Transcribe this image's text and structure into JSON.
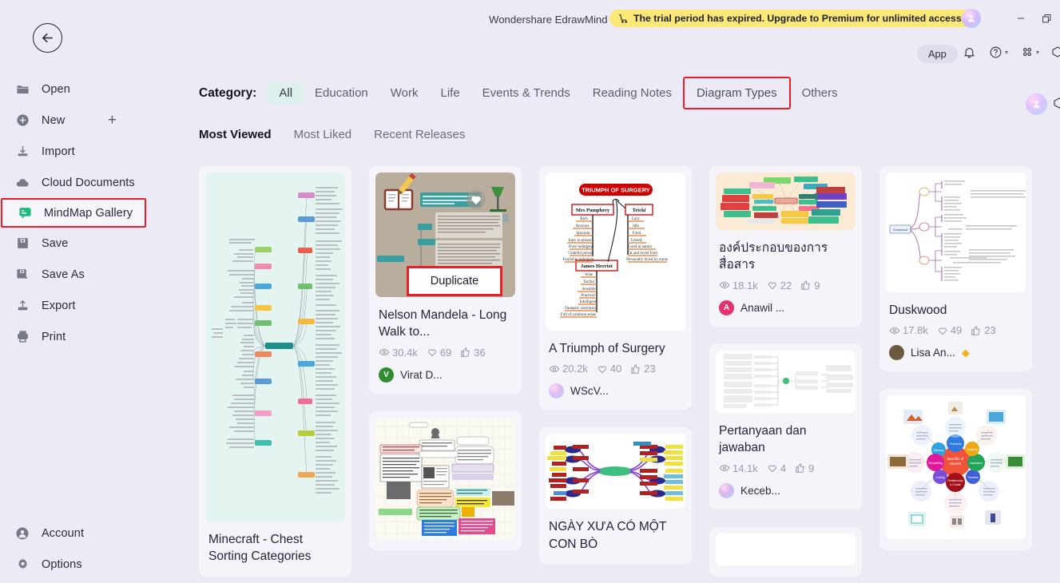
{
  "window": {
    "title": "Wondershare EdrawMind",
    "trial_banner": "The trial period has expired. Upgrade to Premium for unlimited access.",
    "minimize_label": "Minimize",
    "maximize_label": "Restore"
  },
  "toolbar": {
    "app_label": "App",
    "notifications_label": "Notifications",
    "help_label": "Help",
    "grid_label": "Apps",
    "cube_label": "Extras"
  },
  "sidebar": {
    "back_label": "Back",
    "items": [
      {
        "label": "Open",
        "icon": "folder-icon"
      },
      {
        "label": "New",
        "icon": "plus-circle-icon",
        "trailing": "+"
      },
      {
        "label": "Import",
        "icon": "import-icon"
      },
      {
        "label": "Cloud Documents",
        "icon": "cloud-icon"
      },
      {
        "label": "MindMap Gallery",
        "icon": "gallery-icon",
        "selected": true
      },
      {
        "label": "Save",
        "icon": "save-icon"
      },
      {
        "label": "Save As",
        "icon": "save-as-icon"
      },
      {
        "label": "Export",
        "icon": "export-icon"
      },
      {
        "label": "Print",
        "icon": "print-icon"
      }
    ],
    "bottom_items": [
      {
        "label": "Account",
        "icon": "account-icon"
      },
      {
        "label": "Options",
        "icon": "gear-icon"
      }
    ]
  },
  "category": {
    "label": "Category:",
    "tabs": [
      {
        "label": "All",
        "state": "active"
      },
      {
        "label": "Education",
        "state": "normal"
      },
      {
        "label": "Work",
        "state": "normal"
      },
      {
        "label": "Life",
        "state": "normal"
      },
      {
        "label": "Events & Trends",
        "state": "normal"
      },
      {
        "label": "Reading Notes",
        "state": "normal"
      },
      {
        "label": "Diagram Types",
        "state": "highlighted"
      },
      {
        "label": "Others",
        "state": "normal"
      }
    ]
  },
  "sort": {
    "tabs": [
      {
        "label": "Most Viewed",
        "state": "active"
      },
      {
        "label": "Most Liked",
        "state": "normal"
      },
      {
        "label": "Recent Releases",
        "state": "normal"
      }
    ]
  },
  "overlay": {
    "duplicate_label": "Duplicate"
  },
  "cards": {
    "c1": {
      "title": "Minecraft - Chest Sorting Categories"
    },
    "c2": {
      "title": "Nelson Mandela - Long Walk to...",
      "views": "30.4k",
      "likes": "69",
      "thumbs": "36",
      "author": "Virat D...",
      "avatar_letter": "V",
      "avatar_color": "#2E8B2E"
    },
    "c3": {
      "title": "A Triumph of Surgery",
      "views": "20.2k",
      "likes": "40",
      "thumbs": "23",
      "author": "WScV...",
      "avatar_letter": "",
      "avatar_color": "#d9b0e8"
    },
    "c4": {
      "title": "องค์ประกอบของการสื่อสาร",
      "views": "18.1k",
      "likes": "22",
      "thumbs": "9",
      "author": "Anawil ...",
      "avatar_letter": "A",
      "avatar_color": "#E5326E"
    },
    "c5": {
      "title": "Duskwood",
      "views": "17.8k",
      "likes": "49",
      "thumbs": "23",
      "author": "Lisa An...",
      "avatar_letter": "",
      "avatar_color": "#6b5a3e",
      "vip": "◆"
    },
    "c6": {
      "title": "",
      "views": "",
      "likes": "",
      "thumbs": "",
      "author": ""
    },
    "c7": {
      "title": "NGÀY XƯA CÓ MỘT CON BÒ"
    },
    "c8": {
      "title": "Pertanyaan dan jawaban",
      "views": "14.1k",
      "likes": "4",
      "thumbs": "9",
      "author": "Keceb...",
      "avatar_letter": "",
      "avatar_color": "#c8a8e8"
    },
    "c9": {
      "title": ""
    }
  },
  "colors": {
    "background": "#ECEBF5",
    "card": "#F5F4FA",
    "accent_red": "#EE1C25",
    "banner_yellow": "#FCE876",
    "tab_active": "#DCF0EC"
  }
}
